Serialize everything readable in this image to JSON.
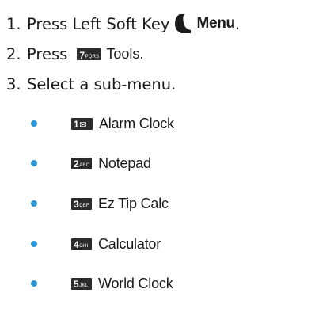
{
  "steps": [
    {
      "number": "1.",
      "text": "Press Left Soft Key",
      "emphasis": "Menu",
      "trailing": "."
    },
    {
      "number": "2.",
      "text": "Press",
      "key": {
        "digit": "7",
        "letters": "PQRS"
      },
      "target": "Tools."
    },
    {
      "number": "3.",
      "text": "Select a sub-menu."
    }
  ],
  "submenu": [
    {
      "key": {
        "digit": "1",
        "icon": "✉"
      },
      "label": "Alarm Clock"
    },
    {
      "key": {
        "digit": "2",
        "letters": "ABC"
      },
      "label": "Notepad"
    },
    {
      "key": {
        "digit": "3",
        "letters": "DEF"
      },
      "label": "Ez Tip Calc"
    },
    {
      "key": {
        "digit": "4",
        "letters": "GHI"
      },
      "label": "Calculator"
    },
    {
      "key": {
        "digit": "5",
        "letters": "JKL"
      },
      "label": "World Clock"
    }
  ],
  "colors": {
    "bullet": "#2b96d4",
    "keycap": "#2b2b2b",
    "text": "#1a1a1a"
  },
  "icons": {
    "softkey": "left-soft-key-icon",
    "voicemail": "envelope-icon"
  }
}
